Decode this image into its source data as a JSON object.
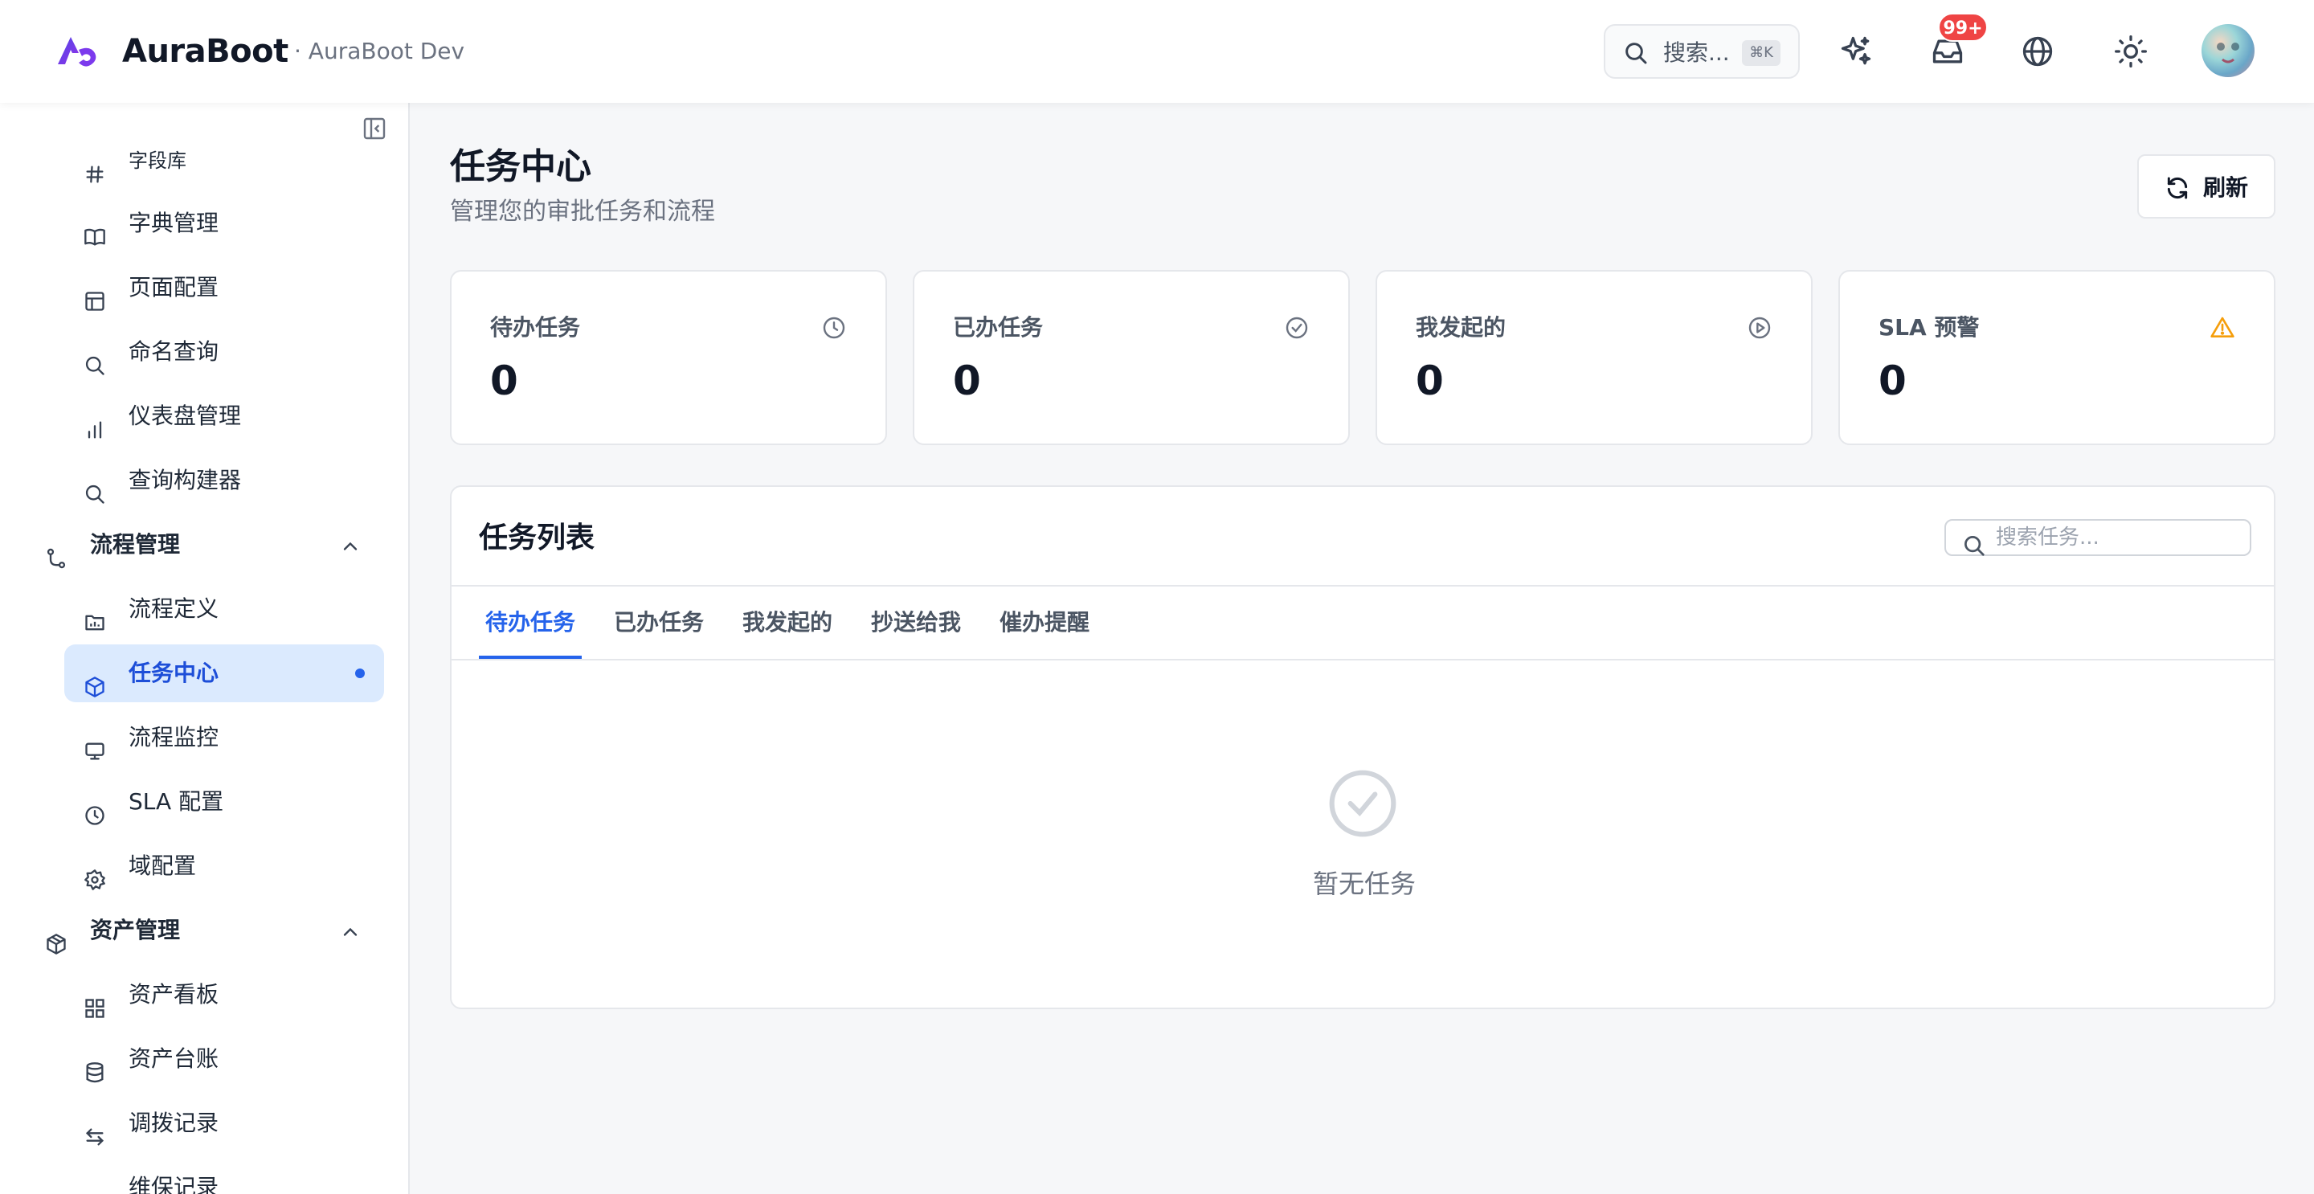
{
  "header": {
    "brand": "AuraBoot",
    "env": "· AuraBoot Dev",
    "search_label": "搜索...",
    "search_shortcut": "⌘K",
    "notification_count": "99+"
  },
  "sidebar": {
    "items": [
      {
        "label": "字段库",
        "icon": "hash-icon"
      },
      {
        "label": "字典管理",
        "icon": "book-icon"
      },
      {
        "label": "页面配置",
        "icon": "layout-icon"
      },
      {
        "label": "命名查询",
        "icon": "search-icon"
      },
      {
        "label": "仪表盘管理",
        "icon": "bar-chart-icon"
      },
      {
        "label": "查询构建器",
        "icon": "search-icon"
      },
      {
        "label": "流程管理",
        "icon": "workflow-icon",
        "group": true,
        "expanded": true
      },
      {
        "label": "流程定义",
        "icon": "folder-chart-icon"
      },
      {
        "label": "任务中心",
        "icon": "cube-icon",
        "active": true
      },
      {
        "label": "流程监控",
        "icon": "monitor-icon"
      },
      {
        "label": "SLA 配置",
        "icon": "clock-icon"
      },
      {
        "label": "域配置",
        "icon": "gear-icon"
      },
      {
        "label": "资产管理",
        "icon": "package-icon",
        "group": true,
        "expanded": true
      },
      {
        "label": "资产看板",
        "icon": "grid-icon"
      },
      {
        "label": "资产台账",
        "icon": "database-icon"
      },
      {
        "label": "调拨记录",
        "icon": "swap-icon"
      },
      {
        "label": "维保记录",
        "icon": "wrench-icon"
      }
    ]
  },
  "main": {
    "title": "任务中心",
    "subtitle": "管理您的审批任务和流程",
    "refresh_label": "刷新",
    "stats": [
      {
        "label": "待办任务",
        "value": "0",
        "icon": "clock-icon"
      },
      {
        "label": "已办任务",
        "value": "0",
        "icon": "check-circle-icon"
      },
      {
        "label": "我发起的",
        "value": "0",
        "icon": "play-circle-icon"
      },
      {
        "label": "SLA 预警",
        "value": "0",
        "icon": "warning-icon"
      }
    ],
    "task_list": {
      "title": "任务列表",
      "search_placeholder": "搜索任务...",
      "tabs": [
        "待办任务",
        "已办任务",
        "我发起的",
        "抄送给我",
        "催办提醒"
      ],
      "active_tab": "待办任务",
      "empty_text": "暂无任务"
    }
  },
  "colors": {
    "accent": "#2563eb",
    "active_bg": "#dbeafe",
    "badge": "#ef4444",
    "warning": "#f59e0b"
  }
}
